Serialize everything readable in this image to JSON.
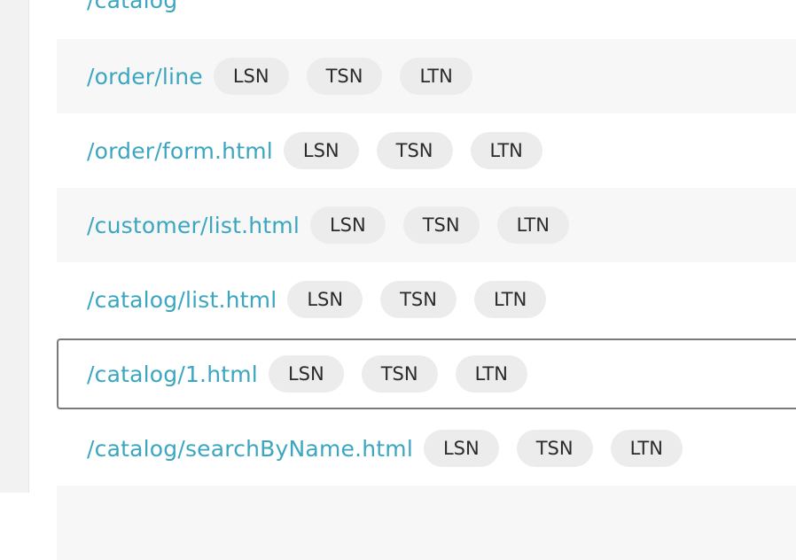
{
  "rows": [
    {
      "path": "/catalog",
      "tags": []
    },
    {
      "path": "/order/line",
      "tags": [
        "LSN",
        "TSN",
        "LTN"
      ]
    },
    {
      "path": "/order/form.html",
      "tags": [
        "LSN",
        "TSN",
        "LTN"
      ]
    },
    {
      "path": "/customer/list.html",
      "tags": [
        "LSN",
        "TSN",
        "LTN"
      ]
    },
    {
      "path": "/catalog/list.html",
      "tags": [
        "LSN",
        "TSN",
        "LTN"
      ]
    },
    {
      "path": "/catalog/1.html",
      "tags": [
        "LSN",
        "TSN",
        "LTN"
      ]
    },
    {
      "path": "/catalog/searchByName.html",
      "tags": [
        "LSN",
        "TSN",
        "LTN"
      ]
    }
  ],
  "selected_row_path": "/catalog/1.html"
}
